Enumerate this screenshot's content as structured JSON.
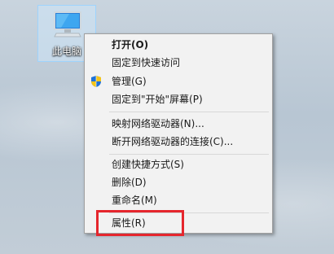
{
  "desktop": {
    "icon": {
      "label": "此电脑",
      "icon_name": "computer-icon"
    }
  },
  "context_menu": {
    "items": [
      {
        "label": "打开(O)",
        "bold": true
      },
      {
        "label": "固定到快速访问"
      },
      {
        "label": "管理(G)",
        "icon": "shield-icon"
      },
      {
        "label": "固定到\"开始\"屏幕(P)"
      },
      {
        "label": "映射网络驱动器(N)..."
      },
      {
        "label": "断开网络驱动器的连接(C)..."
      },
      {
        "label": "创建快捷方式(S)"
      },
      {
        "label": "删除(D)"
      },
      {
        "label": "重命名(M)"
      },
      {
        "label": "属性(R)"
      }
    ]
  },
  "colors": {
    "highlight_border": "#e5262d",
    "menu_background": "#f2f2f2"
  }
}
